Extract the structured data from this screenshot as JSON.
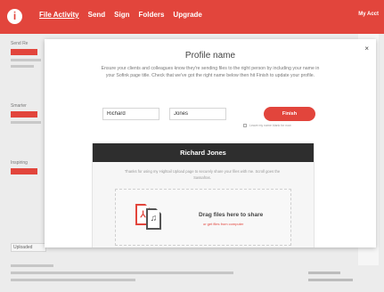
{
  "nav": {
    "logo_glyph": "i",
    "items": [
      {
        "label": "File Activity"
      },
      {
        "label": "Send"
      },
      {
        "label": "Sign"
      },
      {
        "label": "Folders"
      },
      {
        "label": "Upgrade"
      }
    ],
    "account_label": "My Acct"
  },
  "background": {
    "side_headings": [
      "Send Re",
      "Smarter",
      "Inspiring"
    ],
    "bottom_tab": "Uploaded"
  },
  "modal": {
    "close_glyph": "×",
    "title": "Profile name",
    "description": "Ensure your clients and colleagues know they're sending files to the right person by including your name in your Sofink page title. Check that we've got the right name below then hit Finish to update your profile.",
    "first_name": "Richard",
    "last_name": "Jones",
    "save_label": "Finish",
    "leave_label": "Leave my name blank for now"
  },
  "preview": {
    "header": "Richard Jones",
    "description": "Thanks for using my Hightail Upload page to securely share your files with me. Scroll goes the Sassafras.",
    "drag_title": "Drag files here to share",
    "drag_sub": "or get files from computer"
  },
  "colors": {
    "brand_red": "#e2453c",
    "dark_header": "#2e2e2e"
  },
  "icons": [
    "info-logo-icon",
    "close-icon",
    "pdf-file-icon",
    "music-file-icon"
  ]
}
